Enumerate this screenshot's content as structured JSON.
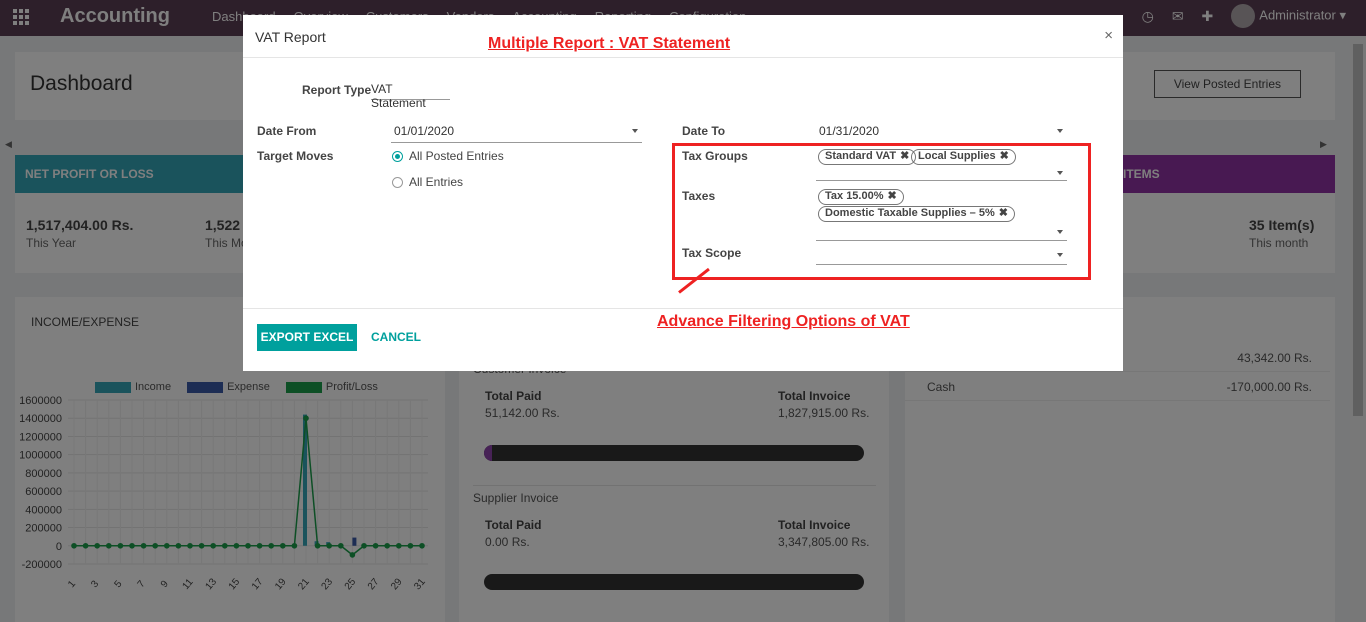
{
  "navbar": {
    "brand": "Accounting",
    "menu": [
      "Dashboard",
      "Overview",
      "Customers",
      "Vendors",
      "Accounting",
      "Reporting",
      "Configuration"
    ],
    "user": "Administrator"
  },
  "dashboard": {
    "title": "Dashboard",
    "view_posted_label": "View Posted Entries",
    "kpi_left_title": "NET PROFIT OR LOSS",
    "kpi_right_title": "ITEMS",
    "kpi_values": [
      {
        "value": "1,517,404.00 Rs.",
        "label": "This Year"
      },
      {
        "value": "1,522",
        "label": "This Mo"
      }
    ],
    "kpi_right": {
      "value": "35 Item(s)",
      "label": "This month"
    },
    "income_expense_title": "INCOME/EXPENSE",
    "customer_invoice_label": "Customer Invoice",
    "supplier_invoice_label": "Supplier Invoice",
    "customer": {
      "total_paid_label": "Total Paid",
      "total_paid": "51,142.00 Rs.",
      "total_invoice_label": "Total Invoice",
      "total_invoice": "1,827,915.00 Rs.",
      "paid_fraction": 0.02
    },
    "supplier": {
      "total_paid_label": "Total Paid",
      "total_paid": "0.00 Rs.",
      "total_invoice_label": "Total Invoice",
      "total_invoice": "3,347,805.00 Rs.",
      "paid_fraction": 0.0
    },
    "accounts": [
      {
        "name": "",
        "value": "43,342.00 Rs."
      },
      {
        "name": "Cash",
        "value": "-170,000.00 Rs."
      }
    ]
  },
  "chart_data": {
    "type": "bar",
    "title": "",
    "legend": [
      "Income",
      "Expense",
      "Profit/Loss"
    ],
    "legend_position": "top",
    "ylim": [
      -200000,
      1600000
    ],
    "yticks": [
      "1600000",
      "1400000",
      "1200000",
      "1000000",
      "800000",
      "600000",
      "400000",
      "200000",
      "0",
      "-200000"
    ],
    "xticks": [
      "1",
      "3",
      "5",
      "7",
      "9",
      "11",
      "13",
      "15",
      "17",
      "19",
      "21",
      "23",
      "25",
      "27",
      "29",
      "31"
    ],
    "x": [
      1,
      2,
      3,
      4,
      5,
      6,
      7,
      8,
      9,
      10,
      11,
      12,
      13,
      14,
      15,
      16,
      17,
      18,
      19,
      20,
      21,
      22,
      23,
      24,
      25,
      26,
      27,
      28,
      29,
      30,
      31
    ],
    "series": [
      {
        "name": "Income",
        "values": [
          0,
          0,
          0,
          0,
          0,
          0,
          0,
          0,
          0,
          0,
          0,
          0,
          0,
          0,
          0,
          0,
          0,
          0,
          0,
          0,
          1440000,
          50000,
          40000,
          0,
          0,
          0,
          0,
          0,
          0,
          0,
          0
        ]
      },
      {
        "name": "Expense",
        "values": [
          0,
          0,
          0,
          0,
          0,
          0,
          0,
          0,
          0,
          0,
          0,
          0,
          0,
          0,
          0,
          0,
          0,
          0,
          0,
          0,
          0,
          0,
          0,
          0,
          90000,
          0,
          0,
          0,
          0,
          0,
          0
        ]
      },
      {
        "name": "Profit/Loss",
        "values": [
          0,
          0,
          0,
          0,
          0,
          0,
          0,
          0,
          0,
          0,
          0,
          0,
          0,
          0,
          0,
          0,
          0,
          0,
          0,
          0,
          1400000,
          0,
          0,
          0,
          -100000,
          0,
          0,
          0,
          0,
          0,
          0
        ]
      }
    ],
    "colors": {
      "Income": "#35a6b8",
      "Expense": "#3b5aa8",
      "Profit/Loss": "#1a9e4a"
    }
  },
  "modal": {
    "title": "VAT Report",
    "close_symbol": "×",
    "annotation_top": "Multiple Report : VAT Statement",
    "annotation_bottom": "Advance Filtering Options of VAT",
    "report_type_label": "Report Type",
    "report_type_value": "VAT Statement",
    "date_from_label": "Date From",
    "date_from_value": "01/01/2020",
    "date_to_label": "Date To",
    "date_to_value": "01/31/2020",
    "target_moves_label": "Target Moves",
    "target_moves_options": [
      "All Posted Entries",
      "All Entries"
    ],
    "tax_groups_label": "Tax Groups",
    "tax_groups": [
      "Standard VAT",
      "Local Supplies"
    ],
    "taxes_label": "Taxes",
    "taxes": [
      "Tax 15.00%",
      "Domestic Taxable Supplies – 5%"
    ],
    "tax_scope_label": "Tax Scope",
    "export_label": "EXPORT EXCEL",
    "cancel_label": "CANCEL"
  }
}
